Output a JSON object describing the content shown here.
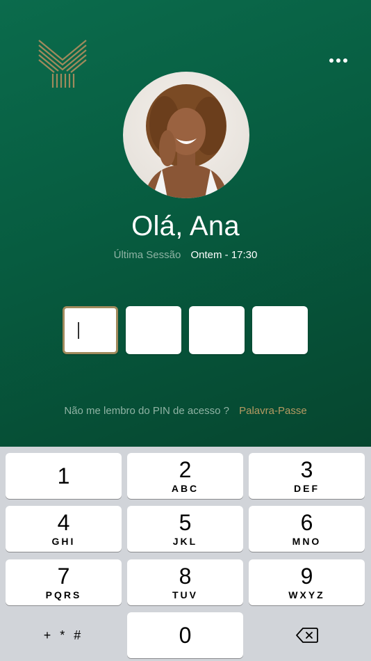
{
  "colors": {
    "brand_green": "#075c40",
    "gold_accent": "#b59a62",
    "keypad_bg": "#d1d4d9"
  },
  "header": {
    "logo_icon": "bank-logo-icon",
    "menu_icon": "more-dots-icon"
  },
  "profile": {
    "greeting": "Olá, Ana",
    "last_session_label": "Última Sessão",
    "last_session_value": "Ontem - 17:30"
  },
  "pin": {
    "digits": 4,
    "filled": 0
  },
  "help": {
    "question": "Não me lembro do PIN de acesso ?",
    "link": "Palavra-Passe"
  },
  "keypad": {
    "keys": [
      {
        "num": "1",
        "letters": ""
      },
      {
        "num": "2",
        "letters": "ABC"
      },
      {
        "num": "3",
        "letters": "DEF"
      },
      {
        "num": "4",
        "letters": "GHI"
      },
      {
        "num": "5",
        "letters": "JKL"
      },
      {
        "num": "6",
        "letters": "MNO"
      },
      {
        "num": "7",
        "letters": "PQRS"
      },
      {
        "num": "8",
        "letters": "TUV"
      },
      {
        "num": "9",
        "letters": "WXYZ"
      },
      {
        "num": "0",
        "letters": ""
      }
    ],
    "symbols": "+ * #",
    "delete_icon": "backspace-icon"
  }
}
